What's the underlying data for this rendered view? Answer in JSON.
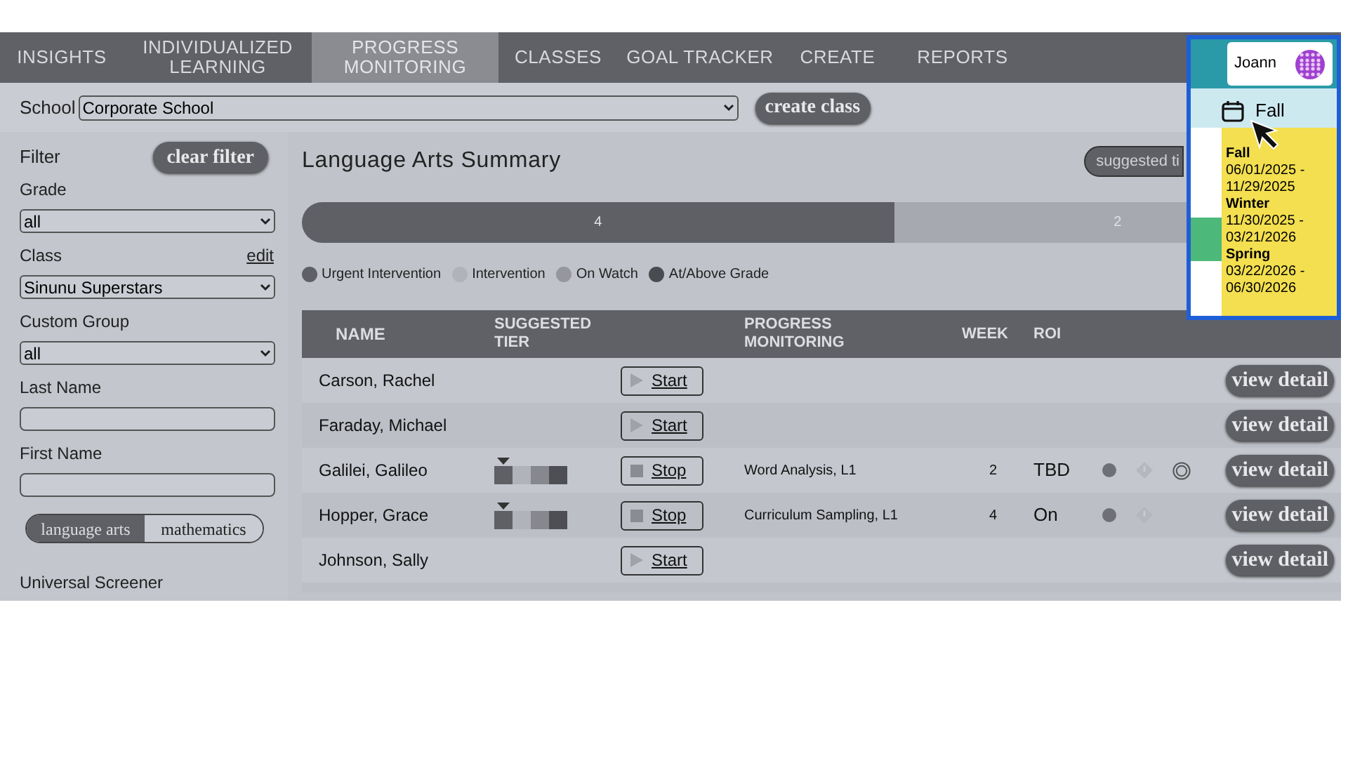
{
  "nav": [
    {
      "label": "INSIGHTS",
      "selected": false
    },
    {
      "label": "INDIVIDUALIZED\nLEARNING",
      "selected": false
    },
    {
      "label": "PROGRESS\nMONITORING",
      "selected": true
    },
    {
      "label": "CLASSES",
      "selected": false
    },
    {
      "label": "GOAL TRACKER",
      "selected": false
    },
    {
      "label": "CREATE",
      "selected": false
    },
    {
      "label": "REPORTS",
      "selected": false
    }
  ],
  "school": {
    "label": "School",
    "value": "Corporate School",
    "button": "create class"
  },
  "filter": {
    "title": "Filter",
    "clear": "clear filter",
    "fields": [
      {
        "kind": "select",
        "label": "Grade",
        "value": "all"
      },
      {
        "kind": "select",
        "label": "Class",
        "link": "edit",
        "value": "Sinunu Superstars"
      },
      {
        "kind": "select",
        "label": "Custom Group",
        "value": "all"
      },
      {
        "kind": "input",
        "label": "Last Name"
      },
      {
        "kind": "input",
        "label": "First Name"
      }
    ],
    "subjects": [
      {
        "label": "language arts",
        "selected": true
      },
      {
        "label": "mathematics",
        "selected": false
      }
    ],
    "section": "Universal Screener"
  },
  "summary": {
    "title": "Language Arts Summary",
    "button": "suggested ti",
    "segments": [
      {
        "label": "4",
        "level": 0.57,
        "color": "#5f6066"
      },
      {
        "label": "2",
        "level": 0.43,
        "color": "#a6a9b0"
      }
    ],
    "legend": [
      {
        "label": "Urgent Intervention",
        "color": "#5f6066"
      },
      {
        "label": "Intervention",
        "color": "#b0b3ba"
      },
      {
        "label": "On Watch",
        "color": "#95979d"
      },
      {
        "label": "At/Above Grade",
        "color": "#4a4b50"
      }
    ]
  },
  "table": {
    "columns": [
      "NAME",
      "SUGGESTED\nTIER",
      "",
      "PROGRESS\nMONITORING",
      "WEEK",
      "ROI"
    ],
    "rows": [
      {
        "name": "Carson, Rachel",
        "tier": [],
        "action": {
          "kind": "start",
          "label": "Start"
        },
        "monitoring": "",
        "week": "",
        "roi": "",
        "dot": false,
        "alert": false,
        "badge": false,
        "detail": "view detail"
      },
      {
        "name": "Faraday, Michael",
        "tier": [],
        "action": {
          "kind": "start",
          "label": "Start"
        },
        "monitoring": "",
        "week": "",
        "roi": "",
        "dot": false,
        "alert": false,
        "badge": false,
        "detail": "view detail"
      },
      {
        "name": "Galilei, Galileo",
        "tier": [
          {
            "color": "#5f6066",
            "selected": true
          },
          {
            "color": "#b0b3ba",
            "selected": false
          },
          {
            "color": "#86888e",
            "selected": false
          },
          {
            "color": "#4e4f54",
            "selected": false
          }
        ],
        "action": {
          "kind": "stop",
          "label": "Stop"
        },
        "monitoring": "Word Analysis, L1",
        "week": "2",
        "roi": "TBD",
        "dot": true,
        "alert": true,
        "badge": true,
        "detail": "view detail"
      },
      {
        "name": "Hopper, Grace",
        "tier": [
          {
            "color": "#5f6066",
            "selected": true
          },
          {
            "color": "#b0b3ba",
            "selected": false
          },
          {
            "color": "#86888e",
            "selected": false
          },
          {
            "color": "#4e4f54",
            "selected": false
          }
        ],
        "action": {
          "kind": "stop",
          "label": "Stop"
        },
        "monitoring": "Curriculum Sampling, L1",
        "week": "4",
        "roi": "On",
        "dot": true,
        "alert": true,
        "badge": false,
        "detail": "view detail"
      },
      {
        "name": "Johnson, Sally",
        "tier": [],
        "action": {
          "kind": "start",
          "label": "Start"
        },
        "monitoring": "",
        "week": "",
        "roi": "",
        "dot": false,
        "alert": false,
        "badge": false,
        "detail": "view detail"
      }
    ]
  },
  "user": {
    "name": "Joann"
  },
  "term": {
    "label": "Fall",
    "periods": [
      {
        "name": "Fall",
        "dates": "06/01/2025 -\n11/29/2025"
      },
      {
        "name": "Winter",
        "dates": "11/30/2025 -\n03/21/2026"
      },
      {
        "name": "Spring",
        "dates": "03/22/2026 -\n06/30/2026"
      }
    ]
  }
}
